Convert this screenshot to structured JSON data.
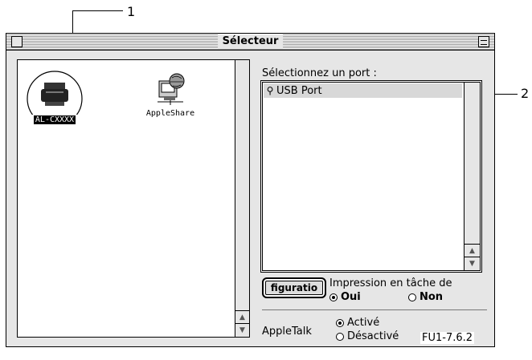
{
  "window": {
    "title": "Sélecteur"
  },
  "callouts": {
    "one": "1",
    "two": "2"
  },
  "left_panel": {
    "items": [
      {
        "label": "AL-CXXXX",
        "icon": "printer-icon",
        "selected": true
      },
      {
        "label": "AppleShare",
        "icon": "appleshare-icon",
        "selected": false
      }
    ]
  },
  "port": {
    "label": "Sélectionnez un port :",
    "items": [
      {
        "label": "USB Port",
        "icon": "usb-icon"
      }
    ]
  },
  "config_button": "figuratio",
  "background_printing": {
    "label": "Impression en tâche de",
    "options": [
      {
        "label": "Oui",
        "selected": true
      },
      {
        "label": "Non",
        "selected": false
      }
    ]
  },
  "appletalk": {
    "label": "AppleTalk",
    "options": [
      {
        "label": "Activé",
        "selected": true
      },
      {
        "label": "Désactivé",
        "selected": false
      }
    ]
  },
  "version": "FU1-7.6.2"
}
